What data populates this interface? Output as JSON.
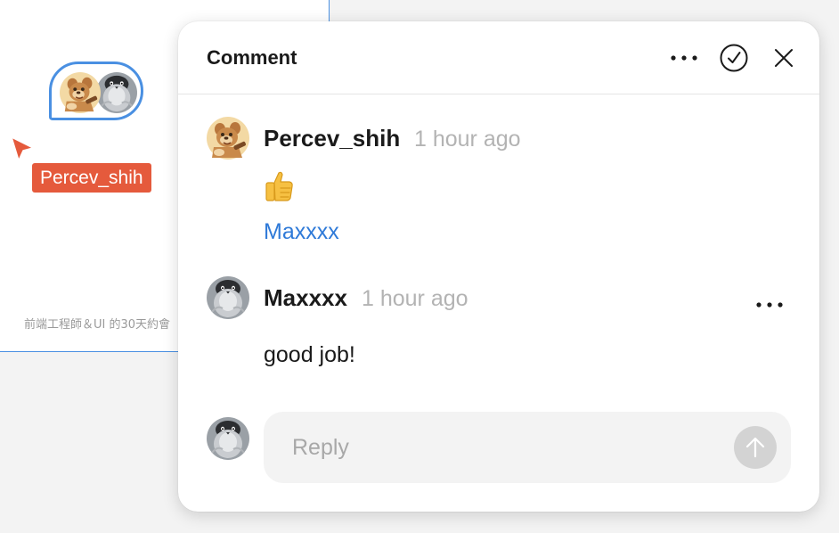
{
  "canvas": {
    "frame_caption": "前端工程師＆UI 的30天約會",
    "cursor_user_label": "Percev_shih",
    "cursor_color": "#e55a3c",
    "frame_border_color": "#4a90e2"
  },
  "panel": {
    "title": "Comment",
    "more_icon": "more-horizontal-icon",
    "resolve_icon": "check-circle-icon",
    "close_icon": "close-icon"
  },
  "comments": [
    {
      "author": "Percev_shih",
      "time": "1 hour ago",
      "avatar": "cartoon-bear-avatar",
      "reaction": "👍",
      "mention": "Maxxxx",
      "mention_color": "#2f7ad8"
    },
    {
      "author": "Maxxxx",
      "time": "1 hour ago",
      "avatar": "penguin-avatar",
      "body": "good job!"
    }
  ],
  "reply": {
    "placeholder": "Reply",
    "value": "",
    "send_icon": "arrow-up-icon"
  }
}
